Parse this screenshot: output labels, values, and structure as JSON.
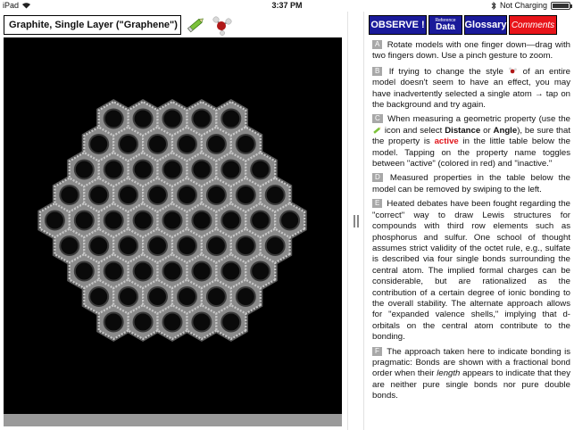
{
  "status_bar": {
    "device": "iPad",
    "time": "3:37 PM",
    "charging": "Not Charging"
  },
  "left_panel": {
    "model_title": "Graphite, Single Layer (\"Graphene\")",
    "icons": {
      "pencil": "pencil-icon",
      "style": "molecule-style-icon"
    }
  },
  "nav": {
    "observe": "OBSERVE !",
    "reference_small": "Reference",
    "reference_big": "Data",
    "glossary": "Glossary",
    "comments": "Comments"
  },
  "notes": {
    "a_tag": "A",
    "a_text": "Rotate models with one finger down—drag with two fingers down. Use a pinch gesture to zoom.",
    "b_tag": "B",
    "b_text1": "If trying to change the style",
    "b_text2": "of an entire model doesn't seem to have an effect, you may have inadvertently selected a single atom → tap on the background and try again.",
    "c_tag": "C",
    "c_text1": "When measuring a geometric property (use the",
    "c_text2": "icon and select",
    "c_distance": "Distance",
    "c_or": "or",
    "c_angle": "Angle",
    "c_text3": "), be sure that the property is",
    "c_active": "active",
    "c_text4": "in the little table below the model. Tapping on the property name toggles between \"active\" (colored in red) and \"inactive.\"",
    "d_tag": "D",
    "d_text": "Measured properties in the table below the model can be removed by swiping to the left.",
    "e_tag": "E",
    "e_text": "Heated debates have been fought regarding the \"correct\" way to draw Lewis structures for compounds with third row elements such as phosphorus and sulfur. One school of thought assumes strict validity of the octet rule, e.g., sulfate is described via four single bonds surrounding the central atom. The implied formal charges can be considerable, but are rationalized as the contribution of a certain degree of ionic bonding to the overall stability. The alternate approach allows for \"expanded valence shells,\" implying that d-orbitals on the central atom contribute to the bonding.",
    "f_tag": "F",
    "f_text1": "The approach taken here to indicate bonding is pragmatic: Bonds are shown with a fractional bond order when their",
    "f_length": "length",
    "f_text2": "appears to indicate that they are neither pure single bonds nor pure double bonds."
  },
  "colors": {
    "nav_blue": "#1a1a9a",
    "comments_red": "#e8141a",
    "active_red": "#e0141a",
    "viewer_background": "#000000"
  }
}
